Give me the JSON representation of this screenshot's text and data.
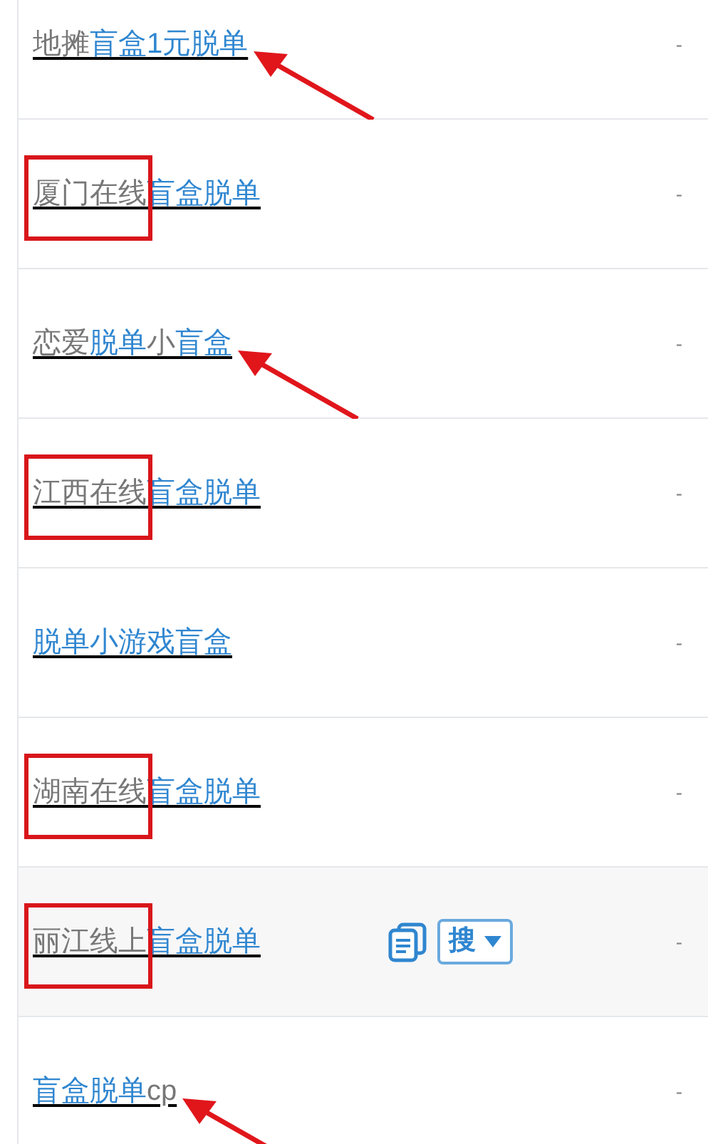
{
  "rows": [
    {
      "parts": [
        {
          "text": "地摊",
          "matched": false
        },
        {
          "text": "盲盒1元脱单",
          "matched": true
        }
      ],
      "framed": false,
      "arrow": true,
      "hovered": false,
      "value": "-"
    },
    {
      "parts": [
        {
          "text": "厦门在线",
          "matched": false
        },
        {
          "text": "盲盒脱单",
          "matched": true
        }
      ],
      "framed": true,
      "arrow": false,
      "hovered": false,
      "value": "-"
    },
    {
      "parts": [
        {
          "text": "恋爱",
          "matched": false
        },
        {
          "text": "脱单",
          "matched": true
        },
        {
          "text": "小",
          "matched": false
        },
        {
          "text": "盲盒",
          "matched": true
        }
      ],
      "framed": false,
      "arrow": true,
      "hovered": false,
      "value": "-"
    },
    {
      "parts": [
        {
          "text": "江西在线",
          "matched": false
        },
        {
          "text": "盲盒脱单",
          "matched": true
        }
      ],
      "framed": true,
      "arrow": false,
      "hovered": false,
      "value": "-"
    },
    {
      "parts": [
        {
          "text": "脱单小游戏盲盒",
          "matched": true
        }
      ],
      "framed": false,
      "arrow": false,
      "hovered": false,
      "value": "-"
    },
    {
      "parts": [
        {
          "text": "湖南在线",
          "matched": false
        },
        {
          "text": "盲盒脱单",
          "matched": true
        }
      ],
      "framed": true,
      "arrow": false,
      "hovered": false,
      "value": "-"
    },
    {
      "parts": [
        {
          "text": "丽江线上",
          "matched": false
        },
        {
          "text": "盲盒脱单",
          "matched": true
        }
      ],
      "framed": true,
      "arrow": false,
      "hovered": true,
      "search_label": "搜",
      "value": "-"
    },
    {
      "parts": [
        {
          "text": "盲盒脱单",
          "matched": true
        },
        {
          "text": "cp",
          "matched": false
        }
      ],
      "framed": false,
      "arrow": true,
      "hovered": false,
      "value": "-"
    }
  ]
}
